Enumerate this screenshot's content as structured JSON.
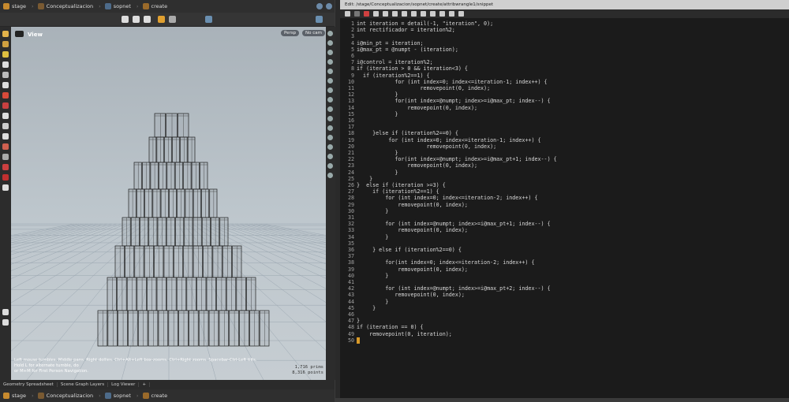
{
  "top_path": {
    "items": [
      "stage",
      "Conceptualizacion",
      "sopnet",
      "create"
    ],
    "colors": [
      "#c78a2e",
      "#7a5a32",
      "#4d6b8a",
      "#9a6a2a"
    ]
  },
  "bottom_path": {
    "items": [
      "stage",
      "Conceptualizacion",
      "sopnet",
      "create"
    ]
  },
  "viewport": {
    "title": "View",
    "persp_label": "Persp",
    "cam_label": "No cam",
    "status_line1": "Left mouse tumbles. Middle pans. Right dollies. Ctrl+Alt+Left box-zooms. Ctrl+Right zooms. Spacebar-Ctrl-Left tilts. Hold L for alternate tumble, do",
    "status_line2": "or M+M for First Person Navigation.",
    "counts_line1": "1,716  prims",
    "counts_line2": "8,316  points"
  },
  "pane_tabs": [
    "Geometry Spreadsheet",
    "Scene Graph Layers",
    "Log Viewer"
  ],
  "editor": {
    "path": "Edit: /stage/Conceptualizacion/sopnet/create/attribwrangle1/snippet",
    "lines": [
      "int iteration = detail(-1, \"iteration\", 0);",
      "int rectificador = iteration%2;",
      "",
      "i@min_pt = iteration;",
      "i@max_pt = @numpt - (iteration);",
      "",
      "i@control = iteration%2;",
      "if (iteration > 0 && iteration<3) {",
      "  if (iteration%2==1) {",
      "            for (int index=0; index<=iteration-1; index++) {",
      "                    removepoint(0, index);",
      "            }",
      "            for(int index=@numpt; index>=i@max_pt; index--) {",
      "                removepoint(0, index);",
      "            }",
      "",
      "",
      "     }else if (iteration%2==0) {",
      "          for (int index=0; index<=iteration-1; index++) {",
      "                      removepoint(0, index);",
      "            }",
      "            for(int index=@numpt; index>=i@max_pt+1; index--) {",
      "                removepoint(0, index);",
      "            }",
      "    }",
      "}  else if (iteration >=3) {",
      "     if (iteration%2==1) {",
      "         for (int index=0; index<=iteration-2; index++) {",
      "             removepoint(0, index);",
      "         }",
      "",
      "         for (int index=@numpt; index>=i@max_pt+1; index--) {",
      "             removepoint(0, index);",
      "         }",
      "",
      "     } else if (iteration%2==0) {",
      "",
      "         for(int index=0; index<=iteration-2; index++) {",
      "             removepoint(0, index);",
      "         }",
      "",
      "         for (int index=@numpt; index>=i@max_pt+2; index--) {",
      "            removepoint(0, index);",
      "         }",
      "     }",
      "",
      "}",
      "if (iteration == 0) {",
      "    removepoint(0, iteration);",
      ""
    ]
  }
}
